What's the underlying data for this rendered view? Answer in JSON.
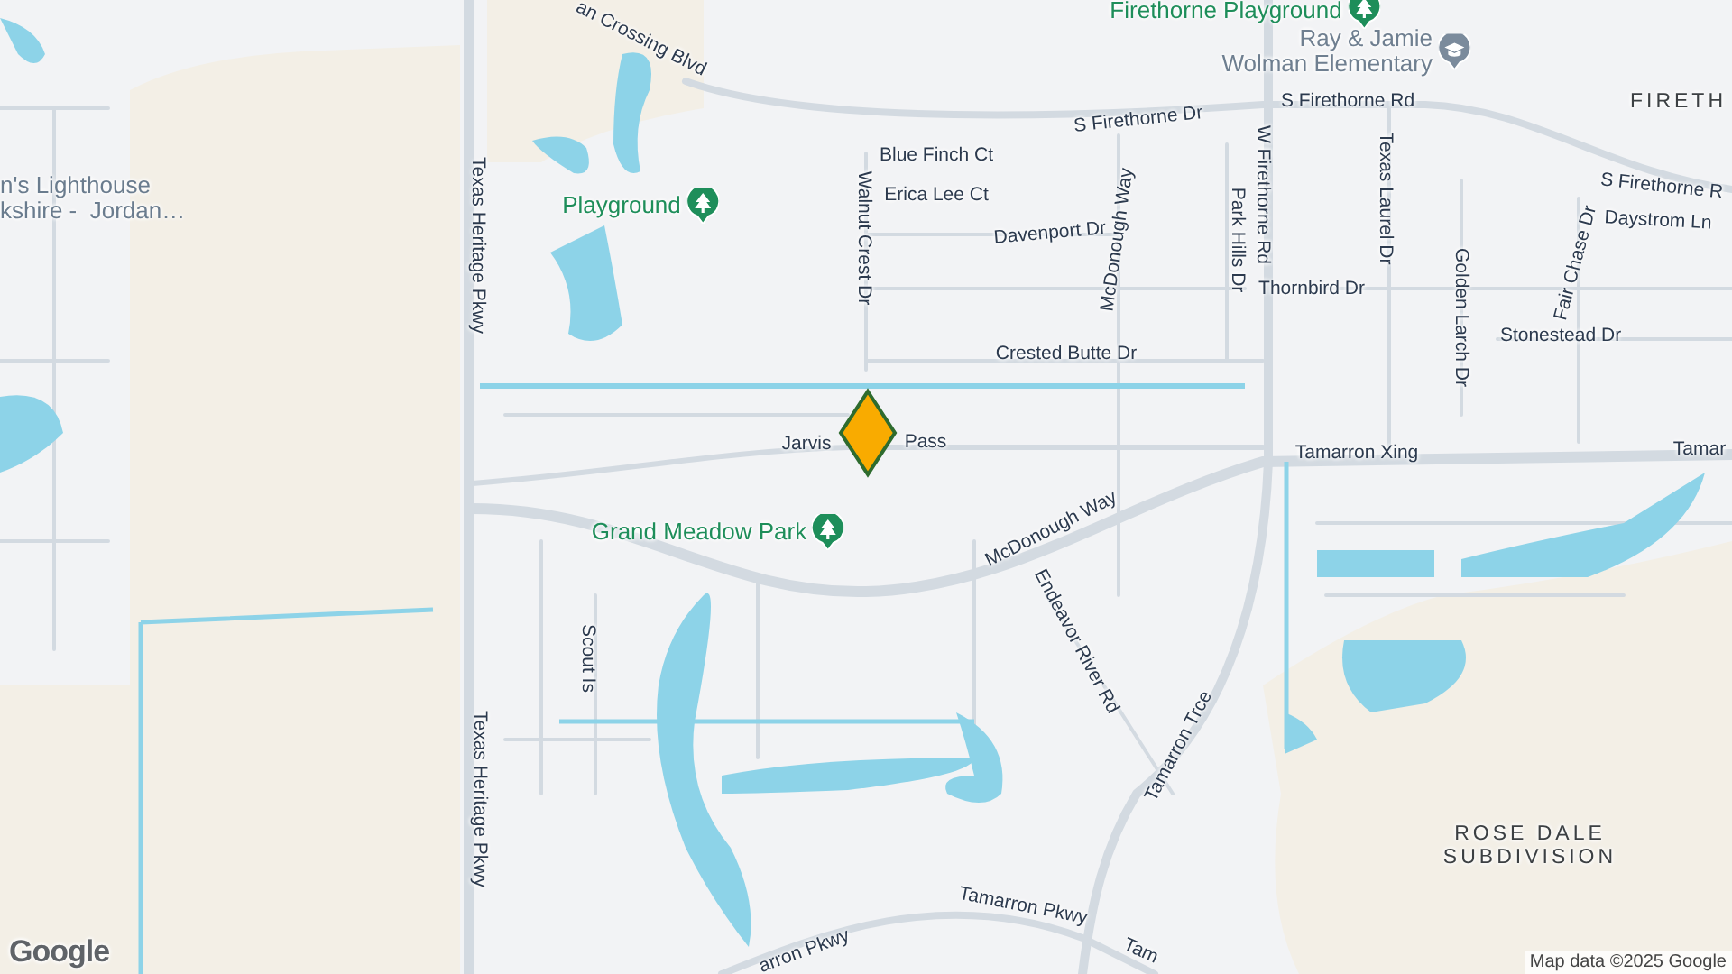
{
  "map": {
    "labels": [
      {
        "kind": "street",
        "lines": [
          "an Crossing Blvd"
        ]
      },
      {
        "kind": "park",
        "lines": [
          "Firethorne Playground"
        ]
      },
      {
        "kind": "school",
        "lines": [
          "Ray & Jamie",
          "Wolman Elementary"
        ]
      },
      {
        "kind": "area",
        "lines": [
          "FIRETH"
        ]
      },
      {
        "kind": "place",
        "lines": [
          "n's Lighthouse"
        ]
      },
      {
        "kind": "place",
        "lines": [
          "kshire -  Jordan…"
        ]
      },
      {
        "kind": "park",
        "lines": [
          "Playground"
        ]
      },
      {
        "kind": "street",
        "lines": [
          "Blue Finch Ct"
        ]
      },
      {
        "kind": "street",
        "lines": [
          "Erica Lee Ct"
        ]
      },
      {
        "kind": "street",
        "lines": [
          "Davenport Dr"
        ]
      },
      {
        "kind": "street",
        "lines": [
          "Walnut Crest Dr"
        ]
      },
      {
        "kind": "street",
        "lines": [
          "S Firethorne Dr"
        ]
      },
      {
        "kind": "street",
        "lines": [
          "S Firethorne Rd"
        ]
      },
      {
        "kind": "street",
        "lines": [
          "McDonough Way"
        ]
      },
      {
        "kind": "street",
        "lines": [
          "Park Hills Dr"
        ]
      },
      {
        "kind": "street",
        "lines": [
          "W Firethorne Rd"
        ]
      },
      {
        "kind": "street",
        "lines": [
          "Texas Laurel Dr"
        ]
      },
      {
        "kind": "street",
        "lines": [
          "Thornbird Dr"
        ]
      },
      {
        "kind": "street",
        "lines": [
          "Golden Larch Dr"
        ]
      },
      {
        "kind": "street",
        "lines": [
          "Fair Chase Dr"
        ]
      },
      {
        "kind": "street",
        "lines": [
          "S Firethorne R"
        ]
      },
      {
        "kind": "street",
        "lines": [
          "Daystrom Ln"
        ]
      },
      {
        "kind": "street",
        "lines": [
          "Stonestead Dr"
        ]
      },
      {
        "kind": "street",
        "lines": [
          "Crested Butte Dr"
        ]
      },
      {
        "kind": "street",
        "lines": [
          "Texas Heritage Pkwy"
        ]
      },
      {
        "kind": "street",
        "lines": [
          "Jarvis"
        ]
      },
      {
        "kind": "street",
        "lines": [
          "Pass"
        ]
      },
      {
        "kind": "street",
        "lines": [
          "Tamarron Xing"
        ]
      },
      {
        "kind": "street",
        "lines": [
          "Tamar"
        ]
      },
      {
        "kind": "park",
        "lines": [
          "Grand Meadow Park"
        ]
      },
      {
        "kind": "street",
        "lines": [
          "McDonough Way"
        ]
      },
      {
        "kind": "street",
        "lines": [
          "Scout Is"
        ]
      },
      {
        "kind": "street",
        "lines": [
          "Texas Heritage Pkwy"
        ]
      },
      {
        "kind": "street",
        "lines": [
          "Endeavor River Rd"
        ]
      },
      {
        "kind": "street",
        "lines": [
          "Tamarron Trce"
        ]
      },
      {
        "kind": "area",
        "lines": [
          "ROSE DALE",
          "SUBDIVISION"
        ]
      },
      {
        "kind": "street",
        "lines": [
          "Tamarron Pkwy"
        ]
      },
      {
        "kind": "street",
        "lines": [
          "arron Pkwy"
        ]
      },
      {
        "kind": "street",
        "lines": [
          "Tam"
        ]
      }
    ],
    "logo": "Google",
    "attribution": "Map data ©2025 Google"
  }
}
